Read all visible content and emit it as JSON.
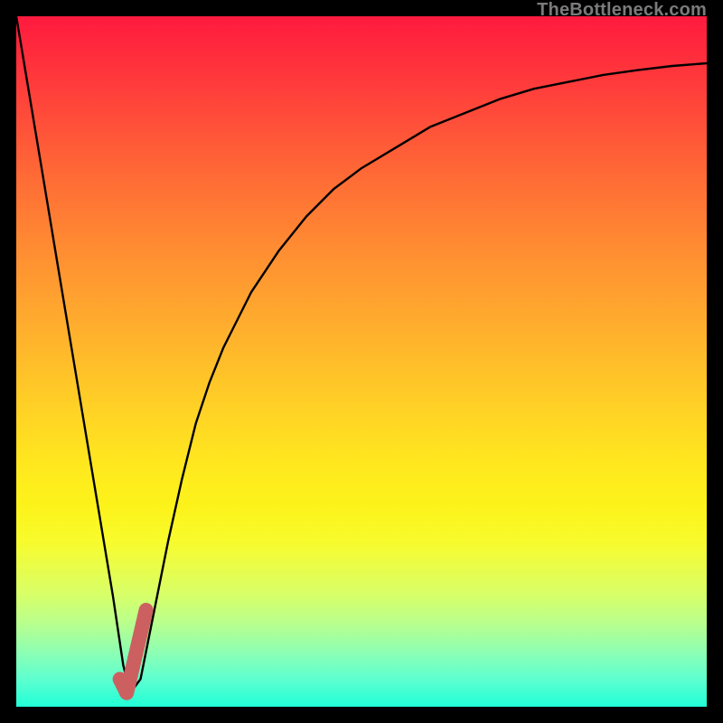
{
  "watermark": "TheBottleneck.com",
  "colors": {
    "background": "#000000",
    "curve": "#000000",
    "marker": "#cc6060",
    "gradient_top": "#ff1a3e",
    "gradient_bottom": "#21ffd6"
  },
  "chart_data": {
    "type": "line",
    "title": "",
    "xlabel": "",
    "ylabel": "",
    "xlim": [
      0,
      100
    ],
    "ylim": [
      0,
      100
    ],
    "grid": false,
    "legend": false,
    "series": [
      {
        "name": "bottleneck-curve",
        "x": [
          0,
          2,
          4,
          6,
          8,
          10,
          12,
          14,
          15.5,
          16.5,
          18,
          20,
          22,
          24,
          26,
          28,
          30,
          34,
          38,
          42,
          46,
          50,
          55,
          60,
          65,
          70,
          75,
          80,
          85,
          90,
          95,
          100
        ],
        "values": [
          100,
          88,
          76,
          64,
          52,
          40,
          28,
          16,
          6,
          2,
          4,
          14,
          24,
          33,
          41,
          47,
          52,
          60,
          66,
          71,
          75,
          78,
          81,
          84,
          86,
          88,
          89.5,
          90.5,
          91.5,
          92.2,
          92.8,
          93.2
        ]
      }
    ],
    "marker": {
      "name": "J-marker",
      "x_start": 15.0,
      "y_start": 4.0,
      "x_corner": 16.0,
      "y_corner": 2.0,
      "x_end": 18.8,
      "y_end": 14.0
    }
  }
}
